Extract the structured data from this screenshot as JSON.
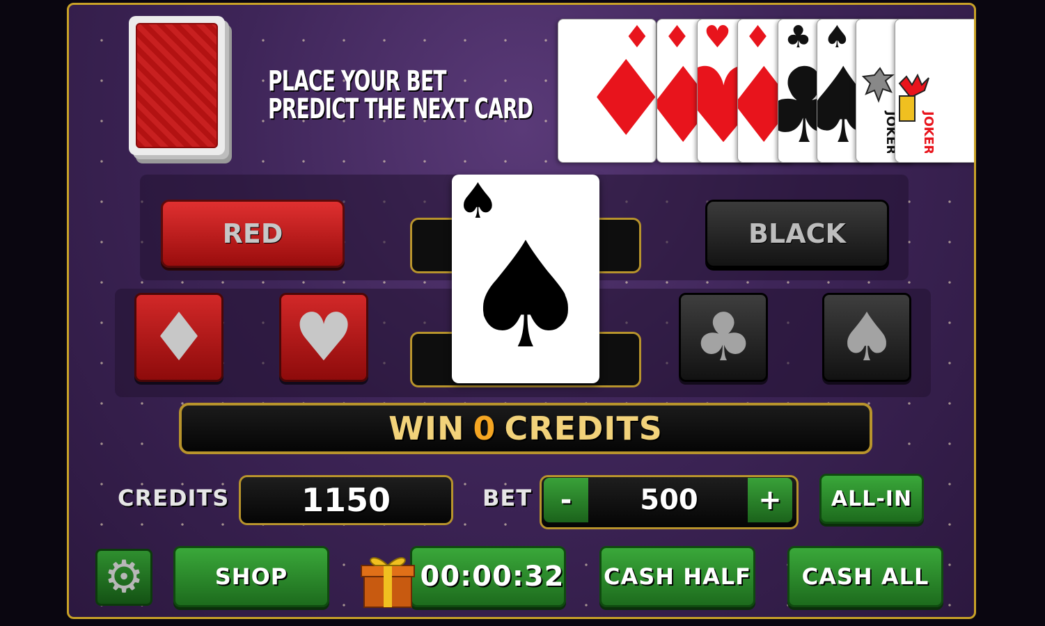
{
  "instructions": {
    "line1": "PLACE YOUR BET",
    "line2": "PREDICT THE NEXT CARD"
  },
  "history_cards": [
    {
      "suit": "♦",
      "color": "red"
    },
    {
      "suit": "♦",
      "color": "red"
    },
    {
      "suit": "♥",
      "color": "red"
    },
    {
      "suit": "♦",
      "color": "red"
    },
    {
      "suit": "♣",
      "color": "black"
    },
    {
      "suit": "♠",
      "color": "black"
    },
    {
      "suit": "JOKER",
      "color": "black"
    },
    {
      "suit": "JOKER",
      "color": "red"
    }
  ],
  "buttons": {
    "red": "RED",
    "black": "BLACK"
  },
  "suits": {
    "diamond": "♦",
    "heart": "♥",
    "club": "♣",
    "spade": "♠"
  },
  "current_card": {
    "suit": "♠"
  },
  "win": {
    "prefix": "WIN",
    "amount": "0",
    "suffix": "CREDITS"
  },
  "credits": {
    "label": "CREDITS",
    "value": "1150"
  },
  "bet": {
    "label": "BET",
    "value": "500",
    "minus": "-",
    "plus": "+"
  },
  "all_in": "ALL-IN",
  "shop": "SHOP",
  "timer": "00:00:32",
  "cash_half": "CASH HALF",
  "cash_all": "CASH ALL",
  "icons": {
    "settings": "gear-icon",
    "gift": "gift-icon"
  },
  "colors": {
    "gold": "#c9a227",
    "red": "#e8141c",
    "green": "#2e8b2e",
    "purple": "#3e2558"
  }
}
